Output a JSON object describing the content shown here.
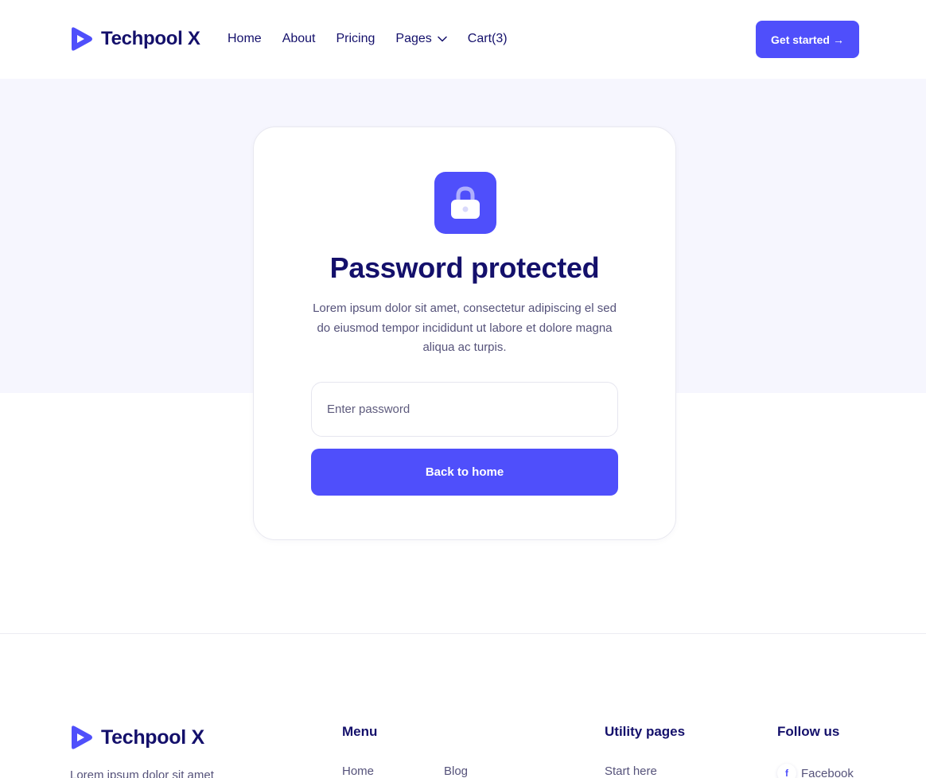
{
  "brand": {
    "name": "Techpool X"
  },
  "nav": {
    "items": [
      {
        "label": "Home"
      },
      {
        "label": "About"
      },
      {
        "label": "Pricing"
      },
      {
        "label": "Pages"
      },
      {
        "label": "Cart(3)"
      }
    ],
    "cta_label": "Get started",
    "cta_arrow": "→"
  },
  "card": {
    "icon": "lock-icon",
    "title": "Password protected",
    "description": "Lorem ipsum dolor sit amet, consectetur adipiscing el sed do eiusmod tempor incididunt ut labore et dolore magna aliqua ac turpis.",
    "input_placeholder": "Enter password",
    "input_value": "",
    "button_label": "Back to home"
  },
  "footer": {
    "brand_name": "Techpool X",
    "tagline": "Lorem ipsum dolor sit amet",
    "menu": {
      "heading": "Menu",
      "links": [
        "Home",
        "Blog"
      ]
    },
    "utility": {
      "heading": "Utility pages",
      "links": [
        "Start here"
      ]
    },
    "follow": {
      "heading": "Follow us",
      "links": [
        {
          "label": "Facebook",
          "icon": "facebook-icon",
          "glyph": "f"
        }
      ]
    }
  },
  "colors": {
    "primary": "#4f4ffb",
    "heading": "#14106b",
    "body_text": "#55527a",
    "band_background": "#f6f6fe"
  }
}
